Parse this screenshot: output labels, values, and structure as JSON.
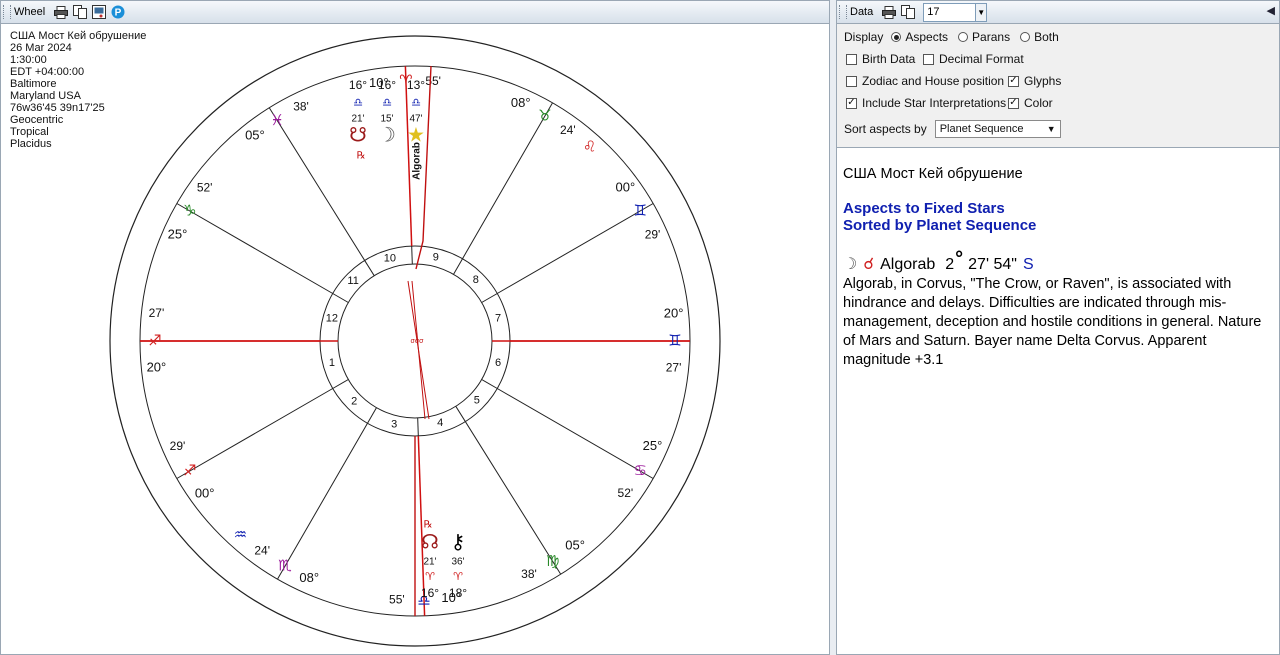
{
  "wheel_panel": {
    "title": "Wheel",
    "info": [
      "США Мост Кей обрушение",
      "26 Mar 2024",
      "1:30:00",
      "EDT +04:00:00",
      "Baltimore",
      "Maryland USA",
      "76w36'45 39n17'25",
      "Geocentric",
      "Tropical",
      "Placidus"
    ],
    "cusps": [
      {
        "deg": "20°",
        "sign": "♐",
        "min": "27'",
        "color": "#d02020"
      },
      {
        "deg": "00°",
        "sign": "♐",
        "min": "29'",
        "color": "#d02020"
      },
      {
        "deg": "08°",
        "sign": "♏",
        "min": "24'",
        "color": "#9b1a9b"
      },
      {
        "deg": "10°",
        "sign": "♎",
        "min": "55'",
        "color": "#1020b0"
      },
      {
        "deg": "05°",
        "sign": "♍",
        "min": "38'",
        "color": "#2a8a2a"
      },
      {
        "deg": "25°",
        "sign": "♋",
        "min": "52'",
        "color": "#9b1a9b"
      },
      {
        "deg": "20°",
        "sign": "♊",
        "min": "27'",
        "color": "#1020b0"
      },
      {
        "deg": "00°",
        "sign": "♊",
        "min": "29'",
        "color": "#1020b0"
      },
      {
        "deg": "08°",
        "sign": "♉",
        "min": "24'",
        "color": "#2a8a2a"
      },
      {
        "deg": "10°",
        "sign": "♈",
        "min": "55'",
        "color": "#d02020"
      },
      {
        "deg": "05°",
        "sign": "♓",
        "min": "38'",
        "color": "#9b1a9b"
      },
      {
        "deg": "25°",
        "sign": "♑",
        "min": "52'",
        "color": "#2a8a2a"
      }
    ],
    "intercepted": [
      {
        "sign": "♌",
        "color": "#d02020"
      },
      {
        "sign": "♒",
        "color": "#1020b0"
      }
    ],
    "house_numbers": [
      "1",
      "2",
      "3",
      "4",
      "5",
      "6",
      "7",
      "8",
      "9",
      "10",
      "11",
      "12"
    ],
    "planets_top": [
      {
        "deg": "16°",
        "sign": "♎",
        "min": "21'",
        "glyph": "☋",
        "retro": "℞",
        "color": "#9b1a1a"
      },
      {
        "deg": "16°",
        "sign": "♎",
        "min": "15'",
        "glyph": "☽",
        "retro": "",
        "color": "#555"
      },
      {
        "deg": "13°",
        "sign": "♎",
        "min": "47'",
        "glyph": "★",
        "retro": "",
        "color": "#e0c020"
      }
    ],
    "star_label": "Algorab",
    "planets_bottom": [
      {
        "deg": "16°",
        "sign": "♈",
        "min": "21'",
        "glyph": "☊",
        "retro": "℞",
        "color": "#9b1a1a"
      },
      {
        "deg": "18°",
        "sign": "♈",
        "min": "36'",
        "glyph": "⚷",
        "retro": "",
        "color": "#000"
      }
    ]
  },
  "data_panel": {
    "title": "Data",
    "combo_value": "17",
    "display_label": "Display",
    "display_options": [
      {
        "label": "Aspects",
        "on": true
      },
      {
        "label": "Parans",
        "on": false
      },
      {
        "label": "Both",
        "on": false
      }
    ],
    "checkboxes": {
      "birth_data": {
        "label": "Birth Data",
        "on": false
      },
      "decimal_format": {
        "label": "Decimal Format",
        "on": false
      },
      "zodiac_house": {
        "label": "Zodiac and House position",
        "on": false
      },
      "glyphs": {
        "label": "Glyphs",
        "on": true
      },
      "star_interp": {
        "label": "Include Star Interpretations",
        "on": true
      },
      "color": {
        "label": "Color",
        "on": true
      }
    },
    "sort_label": "Sort aspects by",
    "sort_value": "Planet Sequence",
    "report": {
      "chart_name": "США Мост Кей обрушение",
      "heading1": "Aspects to Fixed Stars",
      "heading2": "Sorted by Planet Sequence",
      "aspect": {
        "planet": "☽",
        "aspect": "☌",
        "star": "Algorab",
        "degrees": "2",
        "deg_sym": "°",
        "minsec": "27' 54\"",
        "type": "S"
      },
      "interpretation": "Algorab, in Corvus, \"The Crow, or Raven\", is associated with hindrance and delays. Difficulties are indicated through mis-management, deception and hostile conditions in general. Nature of Mars and Saturn. Bayer name Delta Corvus. Apparent magnitude +3.1"
    }
  }
}
